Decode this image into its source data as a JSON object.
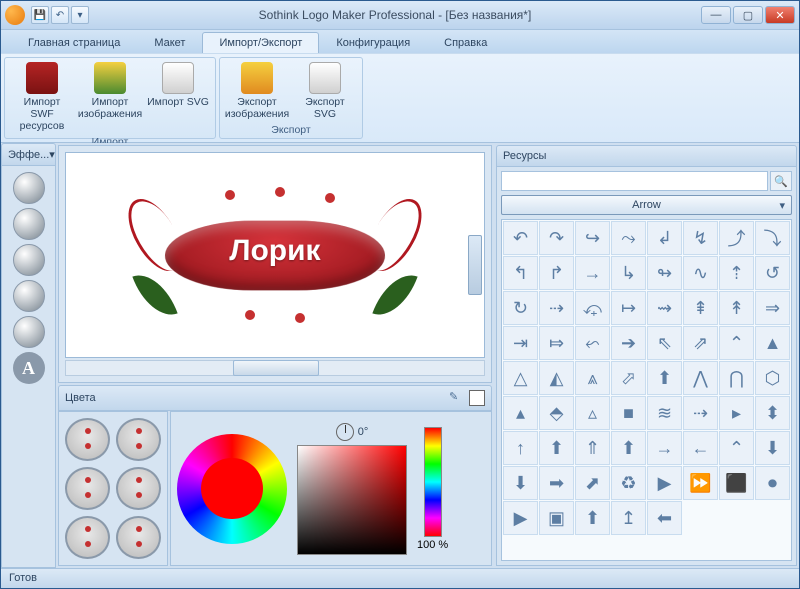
{
  "title": "Sothink Logo Maker Professional - [Без названия*]",
  "tabs": [
    "Главная страница",
    "Макет",
    "Импорт/Экспорт",
    "Конфигурация",
    "Справка"
  ],
  "active_tab": 2,
  "ribbon": {
    "groups": [
      {
        "label": "Импорт",
        "buttons": [
          {
            "label": "Импорт SWF ресурсов"
          },
          {
            "label": "Импорт изображения"
          },
          {
            "label": "Импорт SVG"
          }
        ]
      },
      {
        "label": "Экспорт",
        "buttons": [
          {
            "label": "Экспорт изображения"
          },
          {
            "label": "Экспорт SVG"
          }
        ]
      }
    ]
  },
  "panels": {
    "effects": "Эффе...",
    "colors": "Цвета",
    "resources": "Ресурсы"
  },
  "canvas": {
    "logo_text": "Лорик"
  },
  "colorpicker": {
    "degrees": "0°",
    "percent": "100 %"
  },
  "resources": {
    "search_placeholder": "",
    "category": "Arrow",
    "glyphs": [
      "↶",
      "↷",
      "↪",
      "⤳",
      "↲",
      "↯",
      "⤴",
      "⤵",
      "↰",
      "↱",
      "→",
      "↳",
      "↬",
      "∿",
      "⇡",
      "↺",
      "↻",
      "⇢",
      "⤽",
      "↦",
      "⇝",
      "⇞",
      "↟",
      "⇒",
      "⇥",
      "⤇",
      "⬿",
      "➔",
      "⇖",
      "⇗",
      "⌃",
      "▲",
      "△",
      "◭",
      "⩓",
      "⬀",
      "⬆",
      "⋀",
      "⋂",
      "⬡",
      "▴",
      "⬘",
      "▵",
      "■",
      "≋",
      "⇢",
      "▸",
      "⬍",
      "↑",
      "⬆",
      "⇑",
      "⬆",
      "→",
      "←",
      "⌃",
      "⬇",
      "⬇",
      "➡",
      "⬈",
      "♻",
      "▶",
      "⏩",
      "⬛",
      "⏺",
      "▶",
      "▣",
      "⬆",
      "↥",
      "⬅"
    ]
  },
  "statusbar": "Готов"
}
